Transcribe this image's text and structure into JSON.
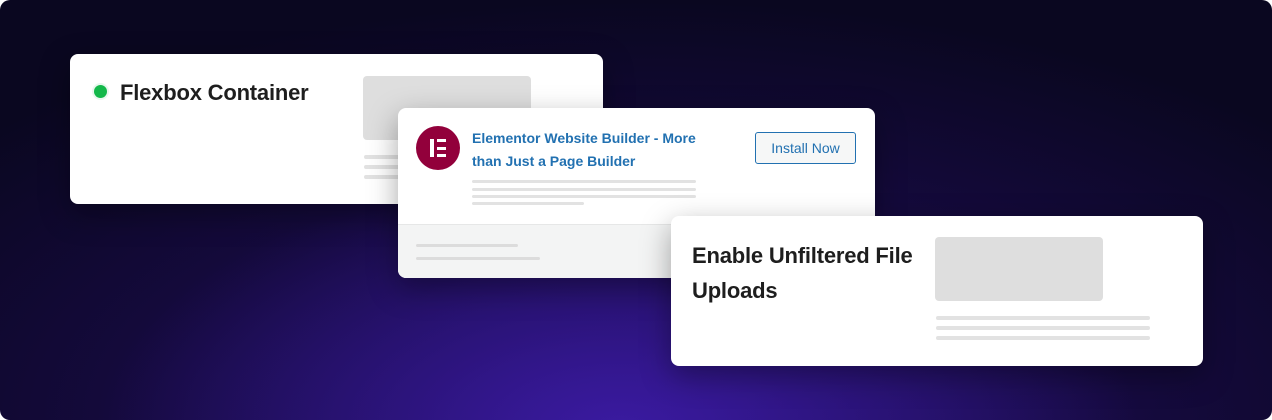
{
  "colors": {
    "background_dark": "#0a0720",
    "background_glow": "#3a1aa0",
    "status_green": "#13b84a",
    "link_blue": "#2271b1",
    "elementor_brand": "#92003b",
    "placeholder_gray": "#dedede"
  },
  "card_flexbox": {
    "status_icon": "green-dot-icon",
    "title": "Flexbox Container"
  },
  "card_plugin": {
    "logo_icon": "elementor-logo-icon",
    "title": "Elementor Website Builder - More than Just a Page Builder",
    "install_label": "Install Now"
  },
  "card_uploads": {
    "title": "Enable Unfiltered File Uploads"
  }
}
